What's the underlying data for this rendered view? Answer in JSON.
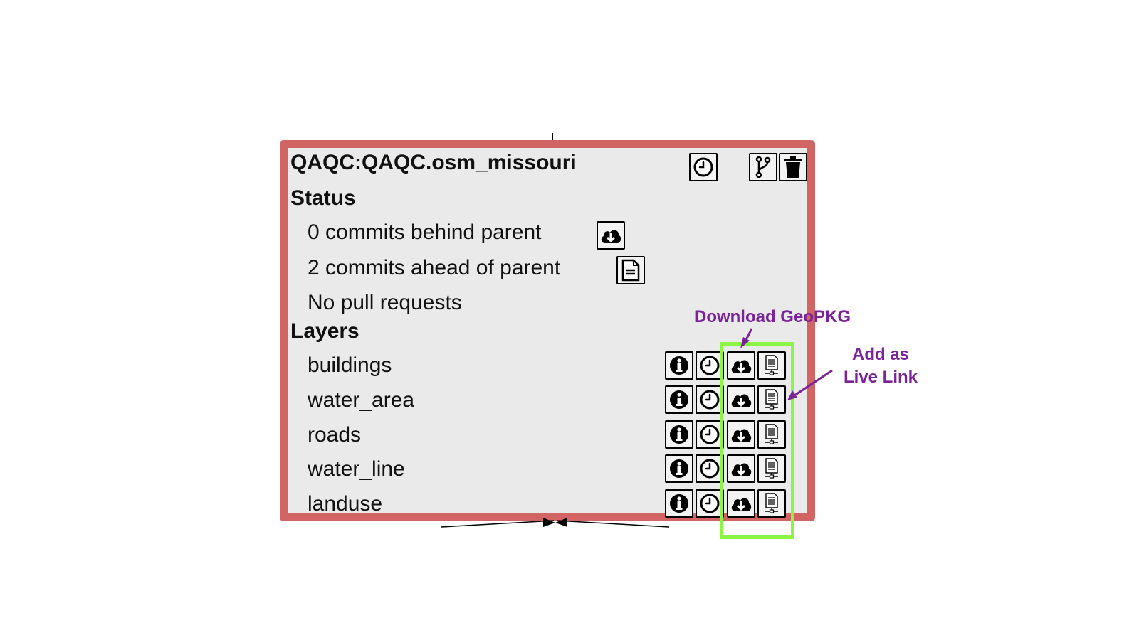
{
  "repo": {
    "title": "QAQC:QAQC.osm_missouri",
    "actions": [
      {
        "name": "history",
        "icon": "clock-icon"
      },
      {
        "name": "branch",
        "icon": "git-branch-icon"
      },
      {
        "name": "delete",
        "icon": "trash-icon"
      }
    ]
  },
  "status": {
    "heading": "Status",
    "behind": {
      "text": "0 commits behind parent",
      "icon": "cloud-download-icon"
    },
    "ahead": {
      "text": "2 commits ahead of parent",
      "icon": "document-icon"
    },
    "pull_requests": "No pull requests"
  },
  "layers": {
    "heading": "Layers",
    "items": [
      {
        "name": "buildings"
      },
      {
        "name": "water_area"
      },
      {
        "name": "roads"
      },
      {
        "name": "water_line"
      },
      {
        "name": "landuse"
      }
    ],
    "row_icons": [
      "info-icon",
      "clock-icon",
      "cloud-download-icon",
      "live-link-icon"
    ]
  },
  "annotations": {
    "download": "Download GeoPKG",
    "live_link_line1": "Add as",
    "live_link_line2": "Live Link",
    "color": "#7a2399",
    "highlight_color": "#8af542"
  },
  "colors": {
    "frame": "#d26463",
    "panel": "#eaeaea"
  }
}
